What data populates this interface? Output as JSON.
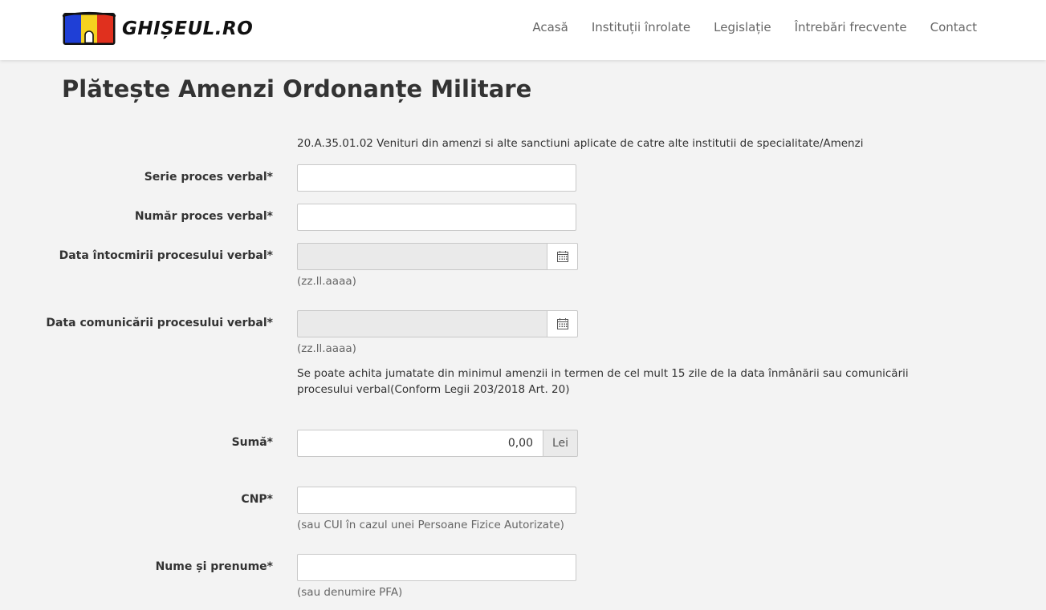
{
  "header": {
    "logo_text": "GHIȘEUL.RO",
    "nav": [
      "Acasă",
      "Instituții înrolate",
      "Legislație",
      "Întrebări frecvente",
      "Contact"
    ]
  },
  "page": {
    "title": "Plătește Amenzi Ordonanțe Militare",
    "fund_code": "20.A.35.01.02 Venituri din amenzi si alte sanctiuni aplicate de catre alte institutii de specialitate/Amenzi"
  },
  "form": {
    "serie_label": "Serie proces verbal*",
    "serie_value": "",
    "numar_label": "Număr proces verbal*",
    "numar_value": "",
    "data_intocmire_label": "Data întocmirii procesului verbal*",
    "data_intocmire_hint": "(zz.ll.aaaa)",
    "data_comunicare_label": "Data comunicării procesului verbal*",
    "data_comunicare_hint": "(zz.ll.aaaa)",
    "note": "Se poate achita jumatate din minimul amenzii in termen de cel mult 15 zile de la data înmânării sau comunicării procesului verbal(Conform Legii 203/2018 Art. 20)",
    "suma_label": "Sumă*",
    "suma_value": "0,00",
    "suma_currency": "Lei",
    "cnp_label": "CNP*",
    "cnp_hint": "(sau CUI în cazul unei Persoane Fizice Autorizate)",
    "nume_label": "Nume și prenume*",
    "nume_hint": "(sau denumire PFA)"
  },
  "colors": {
    "flag_blue": "#1f3fd6",
    "flag_yellow": "#f5d21f",
    "flag_red": "#e0301e",
    "page_bg": "#f3f3f3"
  },
  "icons": [
    "calendar-icon"
  ]
}
